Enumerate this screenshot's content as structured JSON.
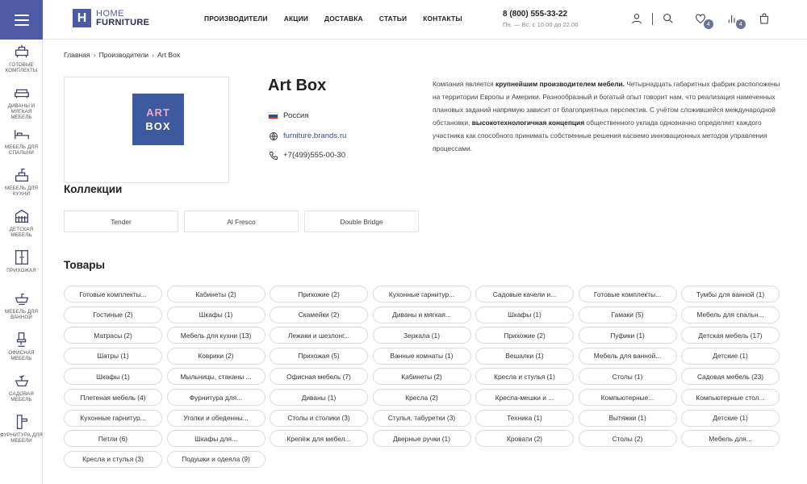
{
  "header": {
    "logo_letter": "H",
    "logo_line1": "HOME",
    "logo_line2": "FURNITURE",
    "nav": [
      "ПРОИЗВОДИТЕЛИ",
      "АКЦИИ",
      "ДОСТАВКА",
      "СТАТЬИ",
      "КОНТАКТЫ"
    ],
    "phone": "8 (800) 555-33-22",
    "hours": "Пн. — Вс. с 10.00 до 22.00",
    "favorites_count": "4",
    "compare_count": "4",
    "icons": [
      "user-icon",
      "search-icon",
      "heart-icon",
      "compare-icon",
      "bag-icon"
    ]
  },
  "sidebar": {
    "items": [
      {
        "label": "ГОТОВЫЕ КОМПЛЕКТЫ",
        "icon": "furniture-set-icon"
      },
      {
        "label": "ДИВАНЫ И МЯГКАЯ МЕБЕЛЬ",
        "icon": "sofa-icon"
      },
      {
        "label": "МЕБЕЛЬ ДЛЯ СПАЛЬНИ",
        "icon": "bed-icon"
      },
      {
        "label": "МЕБЕЛЬ ДЛЯ КУХНИ",
        "icon": "kitchen-icon"
      },
      {
        "label": "ДЕТСКАЯ МЕБЕЛЬ",
        "icon": "crib-icon"
      },
      {
        "label": "ПРИХОЖАЯ",
        "icon": "wardrobe-icon"
      },
      {
        "label": "МЕБЕЛЬ ДЛЯ ВАННОЙ",
        "icon": "bath-sink-icon"
      },
      {
        "label": "ОФИСНАЯ МЕБЕЛЬ",
        "icon": "office-chair-icon"
      },
      {
        "label": "САДОВАЯ МЕБЕЛЬ",
        "icon": "garden-icon"
      },
      {
        "label": "ФУРНИТУРА ДЛЯ МЕБЕЛИ",
        "icon": "door-handle-icon"
      }
    ]
  },
  "breadcrumbs": [
    "Главная",
    "Производители",
    "Art Box"
  ],
  "brand": {
    "logo_top": "ART",
    "logo_bottom": "BOX",
    "name": "Art Box",
    "country": "Россия",
    "site": "furniture.brands.ru",
    "phone": "+7(499)555-00-30",
    "description_parts": [
      {
        "text": "Компания является ",
        "bold": false
      },
      {
        "text": "крупнейшим производителем мебели.",
        "bold": true
      },
      {
        "text": " Четырнадцать габаритных фабрик расположены на территории Европы и Америки. Разнообразный и богатый опыт говорит нам, что реализация намеченных плановых заданий напрямую зависит от благоприятных перспектив. С учётом сложившейся международной обстановки, ",
        "bold": false
      },
      {
        "text": "высокотехнологичная концепция",
        "bold": true
      },
      {
        "text": " общественного уклада однозначно определяет каждого участника как способного принимать собственные решения касаемо инновационных методов управления процессами.",
        "bold": false
      }
    ]
  },
  "collections_title": "Коллекции",
  "collections": [
    "Tender",
    "Al Fresco",
    "Double Bridge"
  ],
  "products_title": "Товары",
  "tags": [
    "Готовые комплекты...",
    "Кабинеты (2)",
    "Прихожие (2)",
    "Кухонные гарнитур...",
    "Садовые качели и...",
    "Готовые комплекты...",
    "Тумбы для ванной (1)",
    "Гостиные (2)",
    "Шкафы (1)",
    "Скамейки (2)",
    "Диваны и мягкая...",
    "Шкафы (1)",
    "Гамаки (5)",
    "Мебель для спальн...",
    "Матрасы (2)",
    "Мебель для кухни (13)",
    "Лежаки и шезлонг...",
    "Зеркала (1)",
    "Прихожие (2)",
    "Пуфики (1)",
    "Детская мебель (17)",
    "Шатры (1)",
    "Коврики (2)",
    "Прихожая (5)",
    "Ванные комнаты (1)",
    "Вешалки (1)",
    "Мебель для ванной...",
    "Детские (1)",
    "Шкафы (1)",
    "Мыльницы, стаканы ...",
    "Офисная мебель (7)",
    "Кабинеты (2)",
    "Кресла и стулья (1)",
    "Столы (1)",
    "Садовая мебель (23)",
    "Плетеная мебель (4)",
    "Фурнитура для...",
    "Диваны (1)",
    "Кресла (2)",
    "Кресла-мешки и ...",
    "Компьютерные...",
    "Компьютерные стол...",
    "Кухонные гарнитур...",
    "Уголки и обеденны...",
    "Столы и столики (3)",
    "Стулья, табуретки (3)",
    "Техника (1)",
    "Вытяжки (1)",
    "Детские (1)",
    "Петли (6)",
    "Шкафы для...",
    "Крепёж для мебел...",
    "Дверные ручки (1)",
    "Кровати (2)",
    "Столы (2)",
    "Мебель для...",
    "Кресла и стулья (3)",
    "Подушки и одеяла (9)"
  ]
}
